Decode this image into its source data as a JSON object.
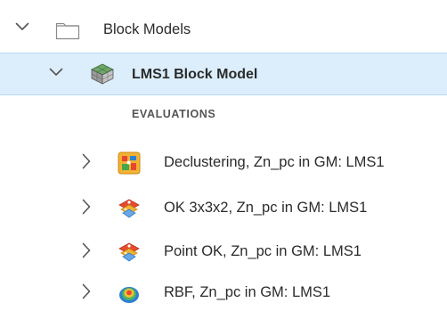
{
  "tree": {
    "root": {
      "label": "Block Models",
      "icon": "folder-icon",
      "expanded": true
    },
    "model": {
      "label": "LMS1 Block Model",
      "icon": "block-model-icon",
      "expanded": true,
      "selected": true,
      "highlight_color": "#dceefb"
    },
    "section_header": "EVALUATIONS",
    "evaluations": [
      {
        "label": "Declustering, Zn_pc in GM: LMS1",
        "icon": "declustering-icon",
        "expanded": false
      },
      {
        "label": "OK 3x3x2, Zn_pc in GM: LMS1",
        "icon": "kriging-icon",
        "expanded": false
      },
      {
        "label": "Point OK, Zn_pc in GM: LMS1",
        "icon": "kriging-icon",
        "expanded": false
      },
      {
        "label": "RBF, Zn_pc in GM: LMS1",
        "icon": "rbf-icon",
        "expanded": false
      }
    ]
  }
}
